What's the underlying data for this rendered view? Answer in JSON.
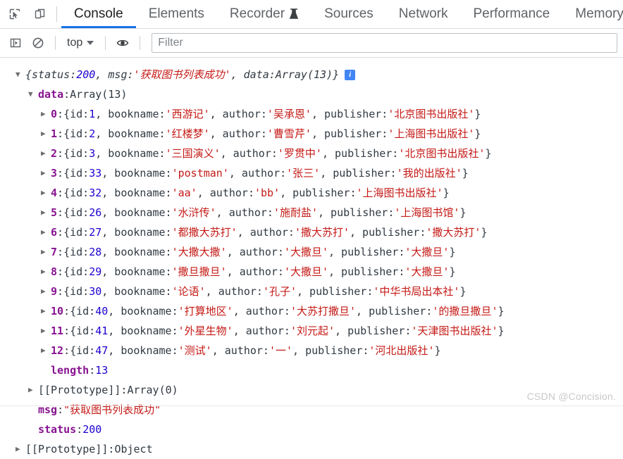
{
  "toolbar": {
    "inspect_icon": "inspect-cursor-icon",
    "device_icon": "device-toolbar-icon",
    "tabs": [
      {
        "label": "Console",
        "active": true,
        "icon": null
      },
      {
        "label": "Elements",
        "active": false,
        "icon": null
      },
      {
        "label": "Recorder",
        "active": false,
        "icon": "flask-icon"
      },
      {
        "label": "Sources",
        "active": false,
        "icon": null
      },
      {
        "label": "Network",
        "active": false,
        "icon": null
      },
      {
        "label": "Performance",
        "active": false,
        "icon": null
      },
      {
        "label": "Memory",
        "active": false,
        "icon": null
      }
    ]
  },
  "optionsbar": {
    "sidebar_icon": "console-sidebar-icon",
    "clear_icon": "clear-console-icon",
    "context_label": "top",
    "eye_icon": "live-expression-icon",
    "filter_placeholder": "Filter",
    "filter_value": ""
  },
  "console": {
    "summary": {
      "open_arrow": "▼",
      "prefix": "{status: ",
      "status_value": "200",
      "mid1": ", msg: ",
      "msg_value": "'获取图书列表成功'",
      "mid2": ", data: ",
      "data_value": "Array(13)",
      "suffix": "}",
      "info_badge": "i"
    },
    "data_node": {
      "open_arrow": "▼",
      "key": "data",
      "colon": ": ",
      "value": "Array(13)"
    },
    "rows": [
      {
        "index": "0",
        "id": "1",
        "bookname": "'西游记'",
        "author": "'吴承恩'",
        "publisher": "'北京图书出版社'"
      },
      {
        "index": "1",
        "id": "2",
        "bookname": "'红楼梦'",
        "author": "'曹雪芹'",
        "publisher": "'上海图书出版社'"
      },
      {
        "index": "2",
        "id": "3",
        "bookname": "'三国演义'",
        "author": "'罗贯中'",
        "publisher": "'北京图书出版社'"
      },
      {
        "index": "3",
        "id": "33",
        "bookname": "'postman'",
        "author": "'张三'",
        "publisher": "'我的出版社'"
      },
      {
        "index": "4",
        "id": "32",
        "bookname": "'aa'",
        "author": "'bb'",
        "publisher": "'上海图书出版社'"
      },
      {
        "index": "5",
        "id": "26",
        "bookname": "'水浒传'",
        "author": "'施耐盐'",
        "publisher": "'上海图书馆'"
      },
      {
        "index": "6",
        "id": "27",
        "bookname": "'都撒大苏打'",
        "author": "'撒大苏打'",
        "publisher": "'撒大苏打'"
      },
      {
        "index": "7",
        "id": "28",
        "bookname": "'大撒大撒'",
        "author": "'大撒旦'",
        "publisher": "'大撒旦'"
      },
      {
        "index": "8",
        "id": "29",
        "bookname": "'撒旦撒旦'",
        "author": "'大撒旦'",
        "publisher": "'大撒旦'"
      },
      {
        "index": "9",
        "id": "30",
        "bookname": "'论语'",
        "author": "'孔子'",
        "publisher": "'中华书局出本社'"
      },
      {
        "index": "10",
        "id": "40",
        "bookname": "'打算地区'",
        "author": "'大苏打撒旦'",
        "publisher": "'的撒旦撒旦'"
      },
      {
        "index": "11",
        "id": "41",
        "bookname": "'外星生物'",
        "author": "'刘元起'",
        "publisher": "'天津图书出版社'"
      },
      {
        "index": "12",
        "id": "47",
        "bookname": "'测试'",
        "author": "'一'",
        "publisher": "'河北出版社'"
      }
    ],
    "row_tokens": {
      "open_brace": "{id: ",
      "bookname_key": ", bookname: ",
      "author_key": ", author: ",
      "publisher_key": ", publisher: ",
      "close_brace": "}",
      "colon": ": "
    },
    "length_row": {
      "key": "length",
      "colon": ": ",
      "value": "13"
    },
    "array_proto_row": {
      "arrow": "▶",
      "key": "[[Prototype]]",
      "colon": ": ",
      "value": "Array(0)"
    },
    "msg_row": {
      "key": "msg",
      "colon": ": ",
      "value": "\"获取图书列表成功\""
    },
    "status_row": {
      "key": "status",
      "colon": ": ",
      "value": "200"
    },
    "object_proto_row": {
      "arrow": "▶",
      "key": "[[Prototype]]",
      "colon": ": ",
      "value": "Object"
    }
  },
  "watermark": "CSDN @Concision.",
  "colors": {
    "accent": "#1a73e8",
    "string": "#c41a16",
    "number": "#1c00cf",
    "key": "#881391",
    "text": "#303942",
    "info_badge_bg": "#4285f4"
  }
}
